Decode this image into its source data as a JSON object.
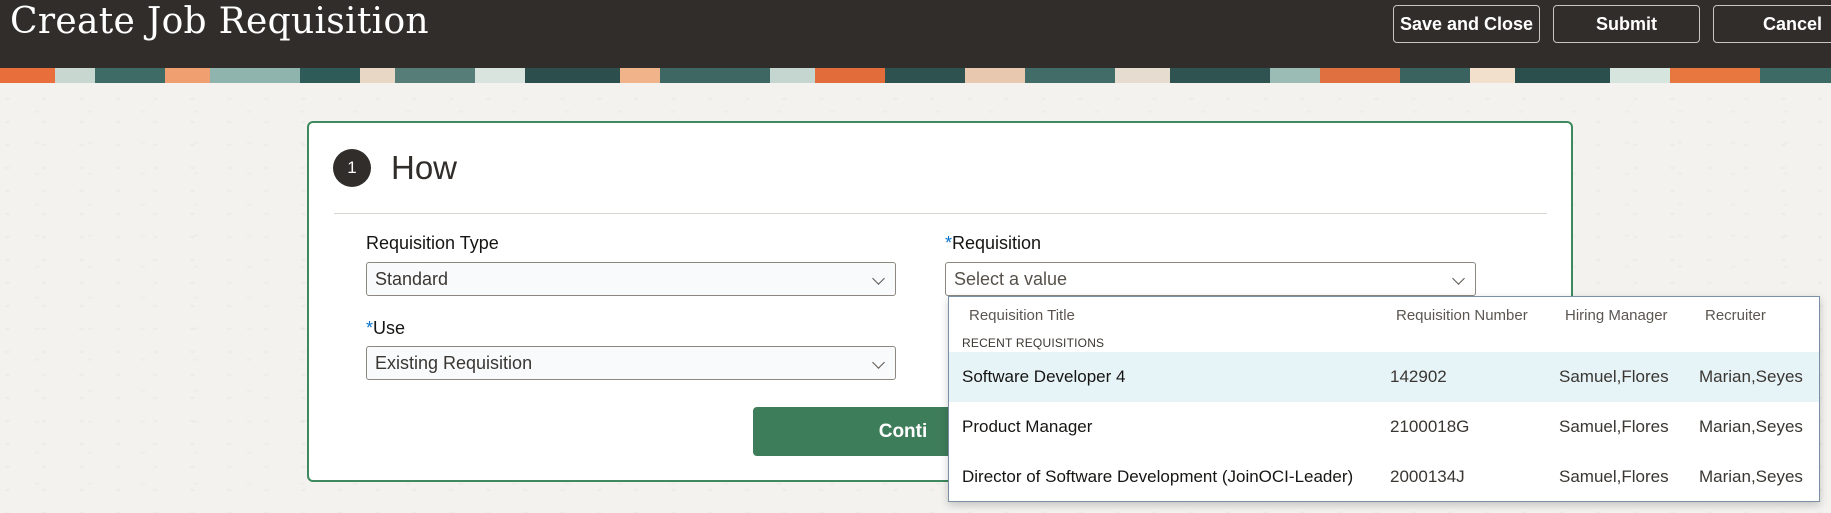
{
  "header": {
    "title": "Create Job Requisition",
    "buttons": {
      "save_close": "Save and Close",
      "submit": "Submit",
      "cancel": "Cancel"
    }
  },
  "colors": {
    "header_bg": "#312d2a",
    "accent_green": "#3e7d5a",
    "card_border": "#3e8a5e",
    "required_star": "#0572ce",
    "row_highlight": "#e6f4f8"
  },
  "step": {
    "number": "1",
    "title": "How"
  },
  "form": {
    "requisition_type": {
      "label": "Requisition Type",
      "value": "Standard"
    },
    "requisition": {
      "required": "*",
      "label": "Requisition",
      "placeholder": "Select a value"
    },
    "use": {
      "required": "*",
      "label": "Use",
      "value": "Existing Requisition"
    }
  },
  "continue_label": "Conti",
  "dropdown": {
    "columns": {
      "title": "Requisition Title",
      "number": "Requisition Number",
      "manager": "Hiring Manager",
      "recruiter": "Recruiter"
    },
    "section_label": "RECENT REQUISITIONS",
    "rows": [
      {
        "title": "Software Developer 4",
        "number": "142902",
        "manager": "Samuel,Flores",
        "recruiter": "Marian,Seyes"
      },
      {
        "title": "Product Manager",
        "number": "2100018G",
        "manager": "Samuel,Flores",
        "recruiter": "Marian,Seyes"
      },
      {
        "title": "Director of Software Development (JoinOCI-Leader)",
        "number": "2000134J",
        "manager": "Samuel,Flores",
        "recruiter": "Marian,Seyes"
      }
    ]
  }
}
